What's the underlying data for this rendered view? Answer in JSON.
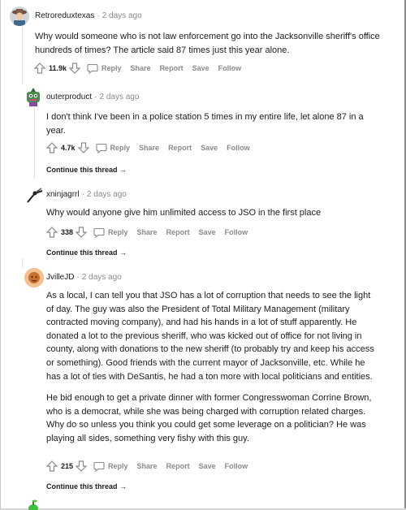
{
  "comments": [
    {
      "username": "Retroreduxtexas",
      "time": "2 days ago",
      "paragraphs": [
        "Why would someone who is not law enforcement go into the Jacksonville sheriff's office hundreds of times? The article said 87 times just this year alone."
      ],
      "score": "11.9k",
      "actions": {
        "reply": "Reply",
        "share": "Share",
        "report": "Report",
        "save": "Save",
        "follow": "Follow"
      }
    },
    {
      "username": "outerproduct",
      "time": "2 days ago",
      "paragraphs": [
        "I don't think I've been in a police station 5 times in my entire life, let alone 87 in a year."
      ],
      "score": "4.7k",
      "actions": {
        "reply": "Reply",
        "share": "Share",
        "report": "Report",
        "save": "Save",
        "follow": "Follow"
      },
      "continue": "Continue this thread →"
    },
    {
      "username": "xninjagrrl",
      "time": "2 days ago",
      "paragraphs": [
        "Why would anyone give him unlimited access to JSO in the first place"
      ],
      "score": "338",
      "actions": {
        "reply": "Reply",
        "share": "Share",
        "report": "Report",
        "save": "Save",
        "follow": "Follow"
      },
      "continue": "Continue this thread →"
    },
    {
      "username": "JvilleJD",
      "time": "2 days ago",
      "paragraphs": [
        "As a local, I can tell you that JSO has a lot of corruption that needs to see the light of day. The guy was also the President of Total Military Management (military contracted moving company), and had his hands in a lot of stuff apparently. He donated a lot to the previous sheriff, who was kicked out of office for not living in county, along with donations to the new sheriff (to probably try and keep his access or something). Good friends with the current mayor of Jacksonville, etc. While he has a lot of ties with DeSantis, he had a ton more with local politicians and entities.",
        "He bid enough to get a private dinner with former Congresswoman Corrine Brown, who is a democrat, while she was being charged with corruption related charges. Why do so unless you think you could get some leverage on a politician? He was playing all sides, something very fishy with this guy."
      ],
      "score": "215",
      "actions": {
        "reply": "Reply",
        "share": "Share",
        "report": "Report",
        "save": "Save",
        "follow": "Follow"
      },
      "continue": "Continue this thread →"
    }
  ],
  "colors": {
    "meta": "#8a8a8a",
    "action": "#878a8c",
    "text": "#1c1c1c"
  }
}
